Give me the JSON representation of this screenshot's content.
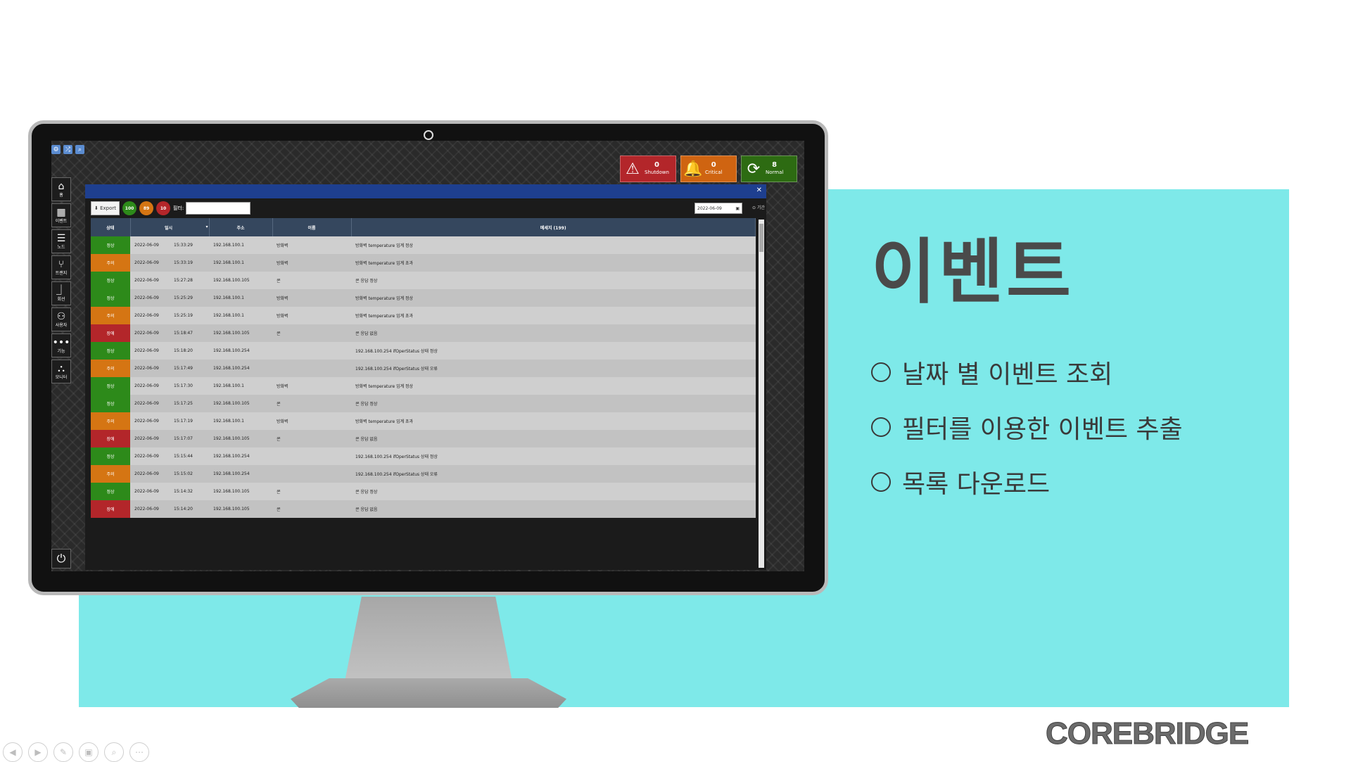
{
  "slide": {
    "title": "이벤트",
    "bullets": [
      "날짜 별 이벤트 조회",
      "필터를 이용한 이벤트 추출",
      "목록 다운로드"
    ],
    "logo": "COREBRIDGE"
  },
  "app": {
    "sidebar": [
      {
        "icon": "⌂",
        "label": "홈"
      },
      {
        "icon": "▦",
        "label": "이벤트"
      },
      {
        "icon": "☰",
        "label": "노드"
      },
      {
        "icon": "⑂",
        "label": "트랜지"
      },
      {
        "icon": "⏌",
        "label": "회선"
      },
      {
        "icon": "⚇",
        "label": "사용자"
      },
      {
        "icon": "•••",
        "label": "기능"
      },
      {
        "icon": "⛬",
        "label": "모니터"
      }
    ],
    "status": {
      "shutdown": {
        "count": "0",
        "label": "Shutdown"
      },
      "critical": {
        "count": "0",
        "label": "Critical"
      },
      "normal": {
        "count": "8",
        "label": "Normal"
      }
    },
    "toolbar": {
      "export_label": "Export",
      "count_green": "100",
      "count_orange": "89",
      "count_red": "10",
      "filter_label": "필터:",
      "date_value": "2022-06-09",
      "period_label": "기간"
    },
    "table": {
      "headers": [
        "상태",
        "일시",
        "",
        "주소",
        "이름",
        "메세지 (199)"
      ],
      "rows": [
        {
          "status": "정상",
          "kind": "ok",
          "date": "2022-06-09",
          "time": "15:33:29",
          "ip": "192.168.100.1",
          "name": "방화벽",
          "msg": "방화벽 temperature 임계 정상"
        },
        {
          "status": "주의",
          "kind": "warn",
          "date": "2022-06-09",
          "time": "15:33:19",
          "ip": "192.168.100.1",
          "name": "방화벽",
          "msg": "방화벽 temperature 임계 초과"
        },
        {
          "status": "정상",
          "kind": "ok",
          "date": "2022-06-09",
          "time": "15:27:28",
          "ip": "192.168.100.105",
          "name": "콘",
          "msg": "콘 응답 정상"
        },
        {
          "status": "정상",
          "kind": "ok",
          "date": "2022-06-09",
          "time": "15:25:29",
          "ip": "192.168.100.1",
          "name": "방화벽",
          "msg": "방화벽 temperature 임계 정상"
        },
        {
          "status": "주의",
          "kind": "warn",
          "date": "2022-06-09",
          "time": "15:25:19",
          "ip": "192.168.100.1",
          "name": "방화벽",
          "msg": "방화벽 temperature 임계 초과"
        },
        {
          "status": "장애",
          "kind": "err",
          "date": "2022-06-09",
          "time": "15:18:47",
          "ip": "192.168.100.105",
          "name": "콘",
          "msg": "콘 응답 없음"
        },
        {
          "status": "정상",
          "kind": "ok",
          "date": "2022-06-09",
          "time": "15:18:20",
          "ip": "192.168.100.254",
          "name": "",
          "msg": "192.168.100.254 ifOperStatus 상태 정상"
        },
        {
          "status": "주의",
          "kind": "warn",
          "date": "2022-06-09",
          "time": "15:17:49",
          "ip": "192.168.100.254",
          "name": "",
          "msg": "192.168.100.254 ifOperStatus 상태 오류"
        },
        {
          "status": "정상",
          "kind": "ok",
          "date": "2022-06-09",
          "time": "15:17:30",
          "ip": "192.168.100.1",
          "name": "방화벽",
          "msg": "방화벽 temperature 임계 정상"
        },
        {
          "status": "정상",
          "kind": "ok",
          "date": "2022-06-09",
          "time": "15:17:25",
          "ip": "192.168.100.105",
          "name": "콘",
          "msg": "콘 응답 정상"
        },
        {
          "status": "주의",
          "kind": "warn",
          "date": "2022-06-09",
          "time": "15:17:19",
          "ip": "192.168.100.1",
          "name": "방화벽",
          "msg": "방화벽 temperature 임계 초과"
        },
        {
          "status": "장애",
          "kind": "err",
          "date": "2022-06-09",
          "time": "15:17:07",
          "ip": "192.168.100.105",
          "name": "콘",
          "msg": "콘 응답 없음"
        },
        {
          "status": "정상",
          "kind": "ok",
          "date": "2022-06-09",
          "time": "15:15:44",
          "ip": "192.168.100.254",
          "name": "",
          "msg": "192.168.100.254 ifOperStatus 상태 정상"
        },
        {
          "status": "주의",
          "kind": "warn",
          "date": "2022-06-09",
          "time": "15:15:02",
          "ip": "192.168.100.254",
          "name": "",
          "msg": "192.168.100.254 ifOperStatus 상태 오류"
        },
        {
          "status": "정상",
          "kind": "ok",
          "date": "2022-06-09",
          "time": "15:14:32",
          "ip": "192.168.100.105",
          "name": "콘",
          "msg": "콘 응답 정상"
        },
        {
          "status": "장애",
          "kind": "err",
          "date": "2022-06-09",
          "time": "15:14:20",
          "ip": "192.168.100.105",
          "name": "콘",
          "msg": "콘 응답 없음"
        }
      ]
    }
  }
}
